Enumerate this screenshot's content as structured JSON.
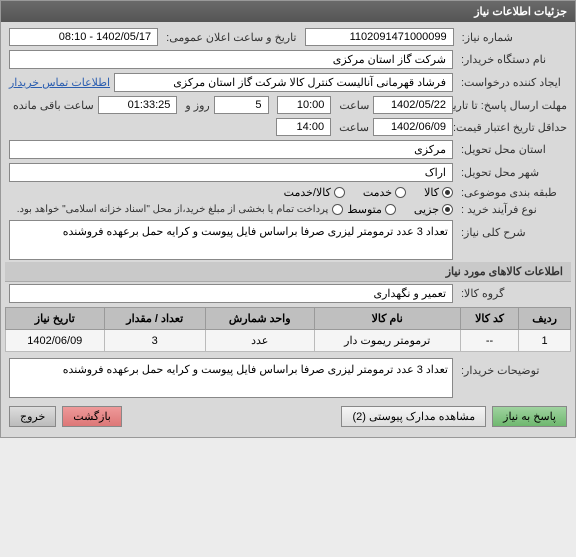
{
  "header": {
    "title": "جزئیات اطلاعات نیاز"
  },
  "fields": {
    "need_no": {
      "label": "شماره نیاز:",
      "value": "1102091471000099"
    },
    "announce": {
      "label": "تاریخ و ساعت اعلان عمومی:",
      "value": "1402/05/17 - 08:10"
    },
    "buyer_org": {
      "label": "نام دستگاه خریدار:",
      "value": "شرکت گاز استان مرکزی"
    },
    "creator": {
      "label": "ایجاد کننده درخواست:",
      "value": "فرشاد قهرمانی آنالیست کنترل کالا شرکت گاز استان مرکزی",
      "link": "اطلاعات تماس خریدار"
    },
    "deadline": {
      "label": "مهلت ارسال پاسخ: تا تاریخ:",
      "date": "1402/05/22",
      "time": "10:00",
      "days": "5",
      "remain": "01:33:25"
    },
    "labels_deadline": {
      "saat": "ساعت",
      "rooz_va": "روز و",
      "baghi": "ساعت باقی مانده"
    },
    "validity": {
      "label": "حداقل تاریخ اعتبار قیمت: تا تاریخ:",
      "date": "1402/06/09",
      "time": "14:00"
    },
    "province": {
      "label": "استان محل تحویل:",
      "value": "مرکزی"
    },
    "city": {
      "label": "شهر محل تحویل:",
      "value": "اراک"
    },
    "subject_class": {
      "label": "طبقه بندی موضوعی:",
      "options": [
        "کالا",
        "خدمت",
        "کالا/خدمت"
      ],
      "selected": 0
    },
    "purchase_type": {
      "label": "نوع فرآیند خرید :",
      "options": [
        "جزیی",
        "متوسط"
      ],
      "selected": 0,
      "note": "پرداخت تمام یا بخشی از مبلغ خرید،از محل \"اسناد خزانه اسلامی\" خواهد بود."
    },
    "general_desc": {
      "label": "شرح کلی نیاز:",
      "value": "تعداد 3 عدد ترمومتر لیزری صرفا براساس فایل پیوست و کرایه حمل برعهده فروشنده"
    }
  },
  "items_section": {
    "title": "اطلاعات کالاهای مورد نیاز"
  },
  "group": {
    "label": "گروه کالا:",
    "value": "تعمیر و نگهداری"
  },
  "table": {
    "headers": [
      "ردیف",
      "کد کالا",
      "نام کالا",
      "واحد شمارش",
      "تعداد / مقدار",
      "تاریخ نیاز"
    ],
    "rows": [
      {
        "idx": "1",
        "code": "--",
        "name": "ترمومتر ریموت دار",
        "unit": "عدد",
        "qty": "3",
        "date": "1402/06/09"
      }
    ]
  },
  "buyer_notes": {
    "label": "توضیحات خریدار:",
    "value": "تعداد 3 عدد ترمومتر لیزری صرفا براساس فایل پیوست و کرایه حمل برعهده فروشنده"
  },
  "buttons": {
    "reply": "پاسخ به نیاز",
    "attachments": "مشاهده مدارک پیوستی (2)",
    "back": "بازگشت",
    "exit": "خروج"
  }
}
